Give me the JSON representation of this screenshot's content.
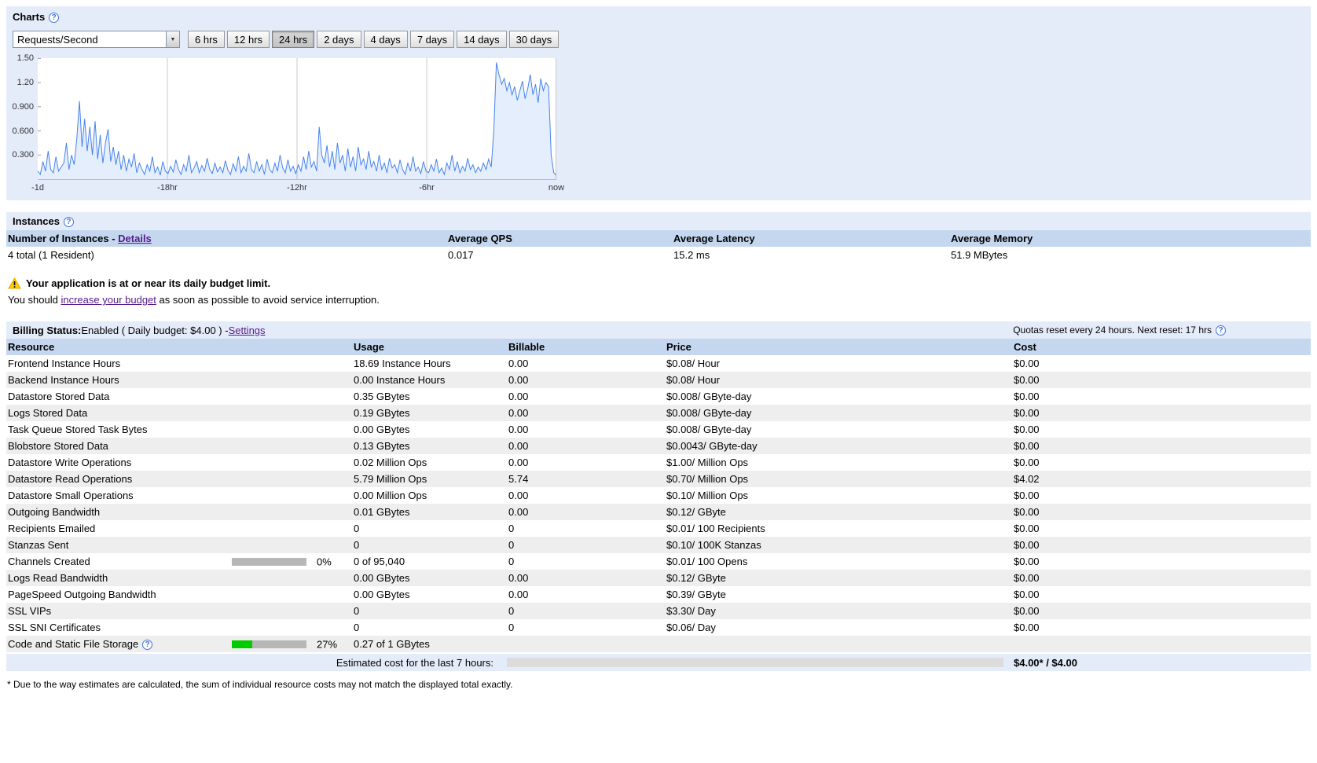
{
  "colors": {
    "panel": "#e5ecf9",
    "table_header": "#c5d7ef",
    "alt_row": "#eeeeee",
    "link": "#551a8b",
    "bar_track": "#b7b7b7",
    "green_bar": "#00cc00",
    "estimate_bar": "#cc0000",
    "chart_line": "#4684ee"
  },
  "charts": {
    "title": "Charts",
    "metric_select": {
      "value": "Requests/Second"
    },
    "ranges": [
      {
        "label": "6 hrs",
        "active": false
      },
      {
        "label": "12 hrs",
        "active": false
      },
      {
        "label": "24 hrs",
        "active": true
      },
      {
        "label": "2 days",
        "active": false
      },
      {
        "label": "4 days",
        "active": false
      },
      {
        "label": "7 days",
        "active": false
      },
      {
        "label": "14 days",
        "active": false
      },
      {
        "label": "30 days",
        "active": false
      }
    ],
    "chart_data": {
      "type": "line",
      "title": "Requests/Second",
      "ylim": [
        0,
        1.5
      ],
      "line_color": "#4684ee",
      "fill_color": "rgba(70,132,238,0.14)",
      "y_ticks": [
        {
          "label": "1.50",
          "value": 1.5
        },
        {
          "label": "1.20",
          "value": 1.2
        },
        {
          "label": "0.900",
          "value": 0.9
        },
        {
          "label": "0.600",
          "value": 0.6
        },
        {
          "label": "0.300",
          "value": 0.3
        }
      ],
      "x_ticks": [
        {
          "label": "-1d",
          "frac": 0
        },
        {
          "label": "-18hr",
          "frac": 0.25
        },
        {
          "label": "-12hr",
          "frac": 0.5
        },
        {
          "label": "-6hr",
          "frac": 0.75
        },
        {
          "label": "now",
          "frac": 1
        }
      ],
      "values": [
        0.1,
        0.06,
        0.22,
        0.1,
        0.35,
        0.12,
        0.08,
        0.28,
        0.1,
        0.15,
        0.2,
        0.45,
        0.12,
        0.3,
        0.18,
        0.5,
        0.97,
        0.4,
        0.75,
        0.35,
        0.65,
        0.3,
        0.72,
        0.25,
        0.55,
        0.2,
        0.45,
        0.62,
        0.22,
        0.4,
        0.18,
        0.35,
        0.12,
        0.3,
        0.1,
        0.25,
        0.15,
        0.32,
        0.08,
        0.2,
        0.12,
        0.06,
        0.18,
        0.1,
        0.28,
        0.08,
        0.15,
        0.05,
        0.22,
        0.1,
        0.07,
        0.16,
        0.09,
        0.24,
        0.12,
        0.06,
        0.18,
        0.1,
        0.3,
        0.08,
        0.14,
        0.22,
        0.08,
        0.17,
        0.1,
        0.26,
        0.12,
        0.07,
        0.2,
        0.09,
        0.15,
        0.08,
        0.23,
        0.11,
        0.06,
        0.19,
        0.1,
        0.28,
        0.08,
        0.16,
        0.1,
        0.32,
        0.12,
        0.08,
        0.22,
        0.1,
        0.18,
        0.06,
        0.25,
        0.12,
        0.08,
        0.2,
        0.1,
        0.3,
        0.14,
        0.08,
        0.24,
        0.1,
        0.16,
        0.07,
        0.18,
        0.1,
        0.28,
        0.12,
        0.35,
        0.15,
        0.22,
        0.1,
        0.65,
        0.3,
        0.2,
        0.42,
        0.15,
        0.35,
        0.12,
        0.45,
        0.2,
        0.3,
        0.1,
        0.38,
        0.15,
        0.28,
        0.1,
        0.4,
        0.18,
        0.25,
        0.12,
        0.35,
        0.15,
        0.22,
        0.1,
        0.3,
        0.12,
        0.2,
        0.08,
        0.26,
        0.14,
        0.18,
        0.08,
        0.24,
        0.12,
        0.06,
        0.2,
        0.1,
        0.28,
        0.1,
        0.15,
        0.07,
        0.22,
        0.1,
        0.08,
        0.18,
        0.1,
        0.25,
        0.08,
        0.14,
        0.06,
        0.2,
        0.12,
        0.3,
        0.1,
        0.22,
        0.08,
        0.16,
        0.1,
        0.26,
        0.12,
        0.18,
        0.08,
        0.15,
        0.1,
        0.2,
        0.12,
        0.25,
        0.15,
        0.6,
        1.45,
        1.3,
        1.18,
        1.25,
        1.1,
        1.2,
        1.05,
        1.15,
        0.98,
        1.1,
        1.22,
        1.0,
        1.12,
        1.3,
        1.05,
        1.18,
        0.95,
        1.25,
        1.1,
        1.2,
        1.15,
        0.3,
        0.08,
        0.05
      ]
    }
  },
  "instances": {
    "title": "Instances",
    "header": {
      "number_label": "Number of Instances",
      "separator": " - ",
      "details_link": "Details",
      "qps": "Average QPS",
      "latency": "Average Latency",
      "memory": "Average Memory"
    },
    "row": {
      "total": "4 total (1 Resident)",
      "qps": "0.017",
      "latency": "15.2 ms",
      "memory": "51.9 MBytes"
    }
  },
  "warning": {
    "title": "Your application is at or near its daily budget limit.",
    "body_prefix": "You should ",
    "link": "increase your budget",
    "body_suffix": " as soon as possible to avoid service interruption."
  },
  "billing": {
    "status_label": "Billing Status:",
    "status_value": " Enabled ( Daily budget: $4.00 ) - ",
    "settings_link": "Settings",
    "quota_note": "Quotas reset every 24 hours. Next reset: 17 hrs",
    "columns": [
      "Resource",
      "Usage",
      "Billable",
      "Price",
      "Cost"
    ],
    "rows": [
      {
        "resource": "Frontend Instance Hours",
        "usage": "18.69 Instance Hours",
        "billable": "0.00",
        "price": "$0.08/ Hour",
        "cost": "$0.00"
      },
      {
        "resource": "Backend Instance Hours",
        "usage": "0.00 Instance Hours",
        "billable": "0.00",
        "price": "$0.08/ Hour",
        "cost": "$0.00"
      },
      {
        "resource": "Datastore Stored Data",
        "usage": "0.35 GBytes",
        "billable": "0.00",
        "price": "$0.008/ GByte-day",
        "cost": "$0.00"
      },
      {
        "resource": "Logs Stored Data",
        "usage": "0.19 GBytes",
        "billable": "0.00",
        "price": "$0.008/ GByte-day",
        "cost": "$0.00"
      },
      {
        "resource": "Task Queue Stored Task Bytes",
        "usage": "0.00 GBytes",
        "billable": "0.00",
        "price": "$0.008/ GByte-day",
        "cost": "$0.00"
      },
      {
        "resource": "Blobstore Stored Data",
        "usage": "0.13 GBytes",
        "billable": "0.00",
        "price": "$0.0043/ GByte-day",
        "cost": "$0.00"
      },
      {
        "resource": "Datastore Write Operations",
        "usage": "0.02 Million Ops",
        "billable": "0.00",
        "price": "$1.00/ Million Ops",
        "cost": "$0.00"
      },
      {
        "resource": "Datastore Read Operations",
        "usage": "5.79 Million Ops",
        "billable": "5.74",
        "price": "$0.70/ Million Ops",
        "cost": "$4.02"
      },
      {
        "resource": "Datastore Small Operations",
        "usage": "0.00 Million Ops",
        "billable": "0.00",
        "price": "$0.10/ Million Ops",
        "cost": "$0.00"
      },
      {
        "resource": "Outgoing Bandwidth",
        "usage": "0.01 GBytes",
        "billable": "0.00",
        "price": "$0.12/ GByte",
        "cost": "$0.00"
      },
      {
        "resource": "Recipients Emailed",
        "usage": "0",
        "billable": "0",
        "price": "$0.01/ 100 Recipients",
        "cost": "$0.00"
      },
      {
        "resource": "Stanzas Sent",
        "usage": "0",
        "billable": "0",
        "price": "$0.10/ 100K Stanzas",
        "cost": "$0.00"
      },
      {
        "resource": "Channels Created",
        "bar": {
          "percent": 0,
          "label": "0%"
        },
        "usage": "0 of 95,040",
        "billable": "0",
        "price": "$0.01/ 100 Opens",
        "cost": "$0.00"
      },
      {
        "resource": "Logs Read Bandwidth",
        "usage": "0.00 GBytes",
        "billable": "0.00",
        "price": "$0.12/ GByte",
        "cost": "$0.00"
      },
      {
        "resource": "PageSpeed Outgoing Bandwidth",
        "usage": "0.00 GBytes",
        "billable": "0.00",
        "price": "$0.39/ GByte",
        "cost": "$0.00"
      },
      {
        "resource": "SSL VIPs",
        "usage": "0",
        "billable": "0",
        "price": "$3.30/ Day",
        "cost": "$0.00"
      },
      {
        "resource": "SSL SNI Certificates",
        "usage": "0",
        "billable": "0",
        "price": "$0.06/ Day",
        "cost": "$0.00"
      },
      {
        "resource": "Code and Static File Storage",
        "help": true,
        "bar": {
          "percent": 27,
          "label": "27%",
          "color": "#00cc00"
        },
        "usage": "0.27 of 1 GBytes",
        "billable": "",
        "price": "",
        "cost": ""
      }
    ],
    "estimate": {
      "label": "Estimated cost for the last 7 hours:",
      "bar_pct": 100,
      "bar_color": "#cc0000",
      "value": "$4.00* / $4.00"
    },
    "footnote": "* Due to the way estimates are calculated, the sum of individual resource costs may not match the displayed total exactly."
  }
}
